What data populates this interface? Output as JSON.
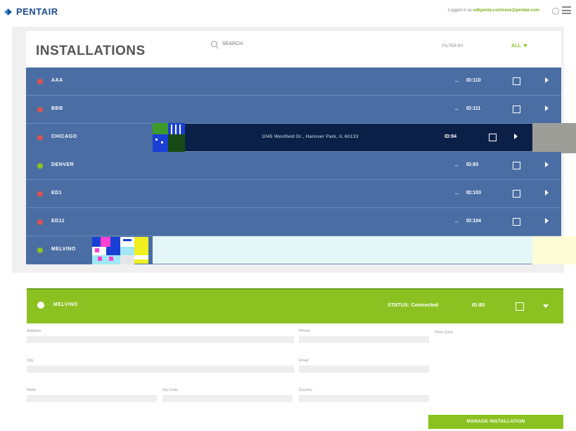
{
  "header": {
    "brand": "PENTAIR",
    "logged_in_prefix": "Logged in as",
    "logged_in_email": "edkpenta.cochrane@pentair.com"
  },
  "installations": {
    "title": "INSTALLATIONS",
    "search_placeholder": "SEARCH",
    "filter_label": "FILTER BY",
    "filter_value": "ALL",
    "rows": [
      {
        "name": "AAA",
        "status": "offline",
        "dash": "–",
        "id": "ID:110"
      },
      {
        "name": "BBB",
        "status": "offline",
        "dash": "–",
        "id": "ID:111"
      },
      {
        "name": "CHICAGO",
        "status": "offline",
        "address": "1045 Westfield Dr., Hanover Park, IL 60133",
        "id": "ID:84"
      },
      {
        "name": "DENVER",
        "status": "online",
        "dash": "–",
        "id": "ID:83"
      },
      {
        "name": "ED1",
        "status": "offline",
        "dash": "–",
        "id": "ID:103"
      },
      {
        "name": "ED11",
        "status": "offline",
        "dash": "–",
        "id": "ID:104"
      },
      {
        "name": "MELVINO",
        "status": "online"
      }
    ]
  },
  "detail": {
    "name": "MELVINO",
    "status_text": "STATUS: Connected",
    "id": "ID:80",
    "labels": {
      "address": "Address",
      "phone": "Phone",
      "city": "City",
      "email": "Email",
      "state": "State",
      "zip": "Zip Code",
      "country": "Country",
      "timezone": "Time Zone"
    },
    "manage_button": "MANAGE INSTALLATION"
  },
  "colors": {
    "row_blue": "#4a6ea4",
    "accent_green": "#8bc221",
    "offline_red": "#d9534f"
  }
}
